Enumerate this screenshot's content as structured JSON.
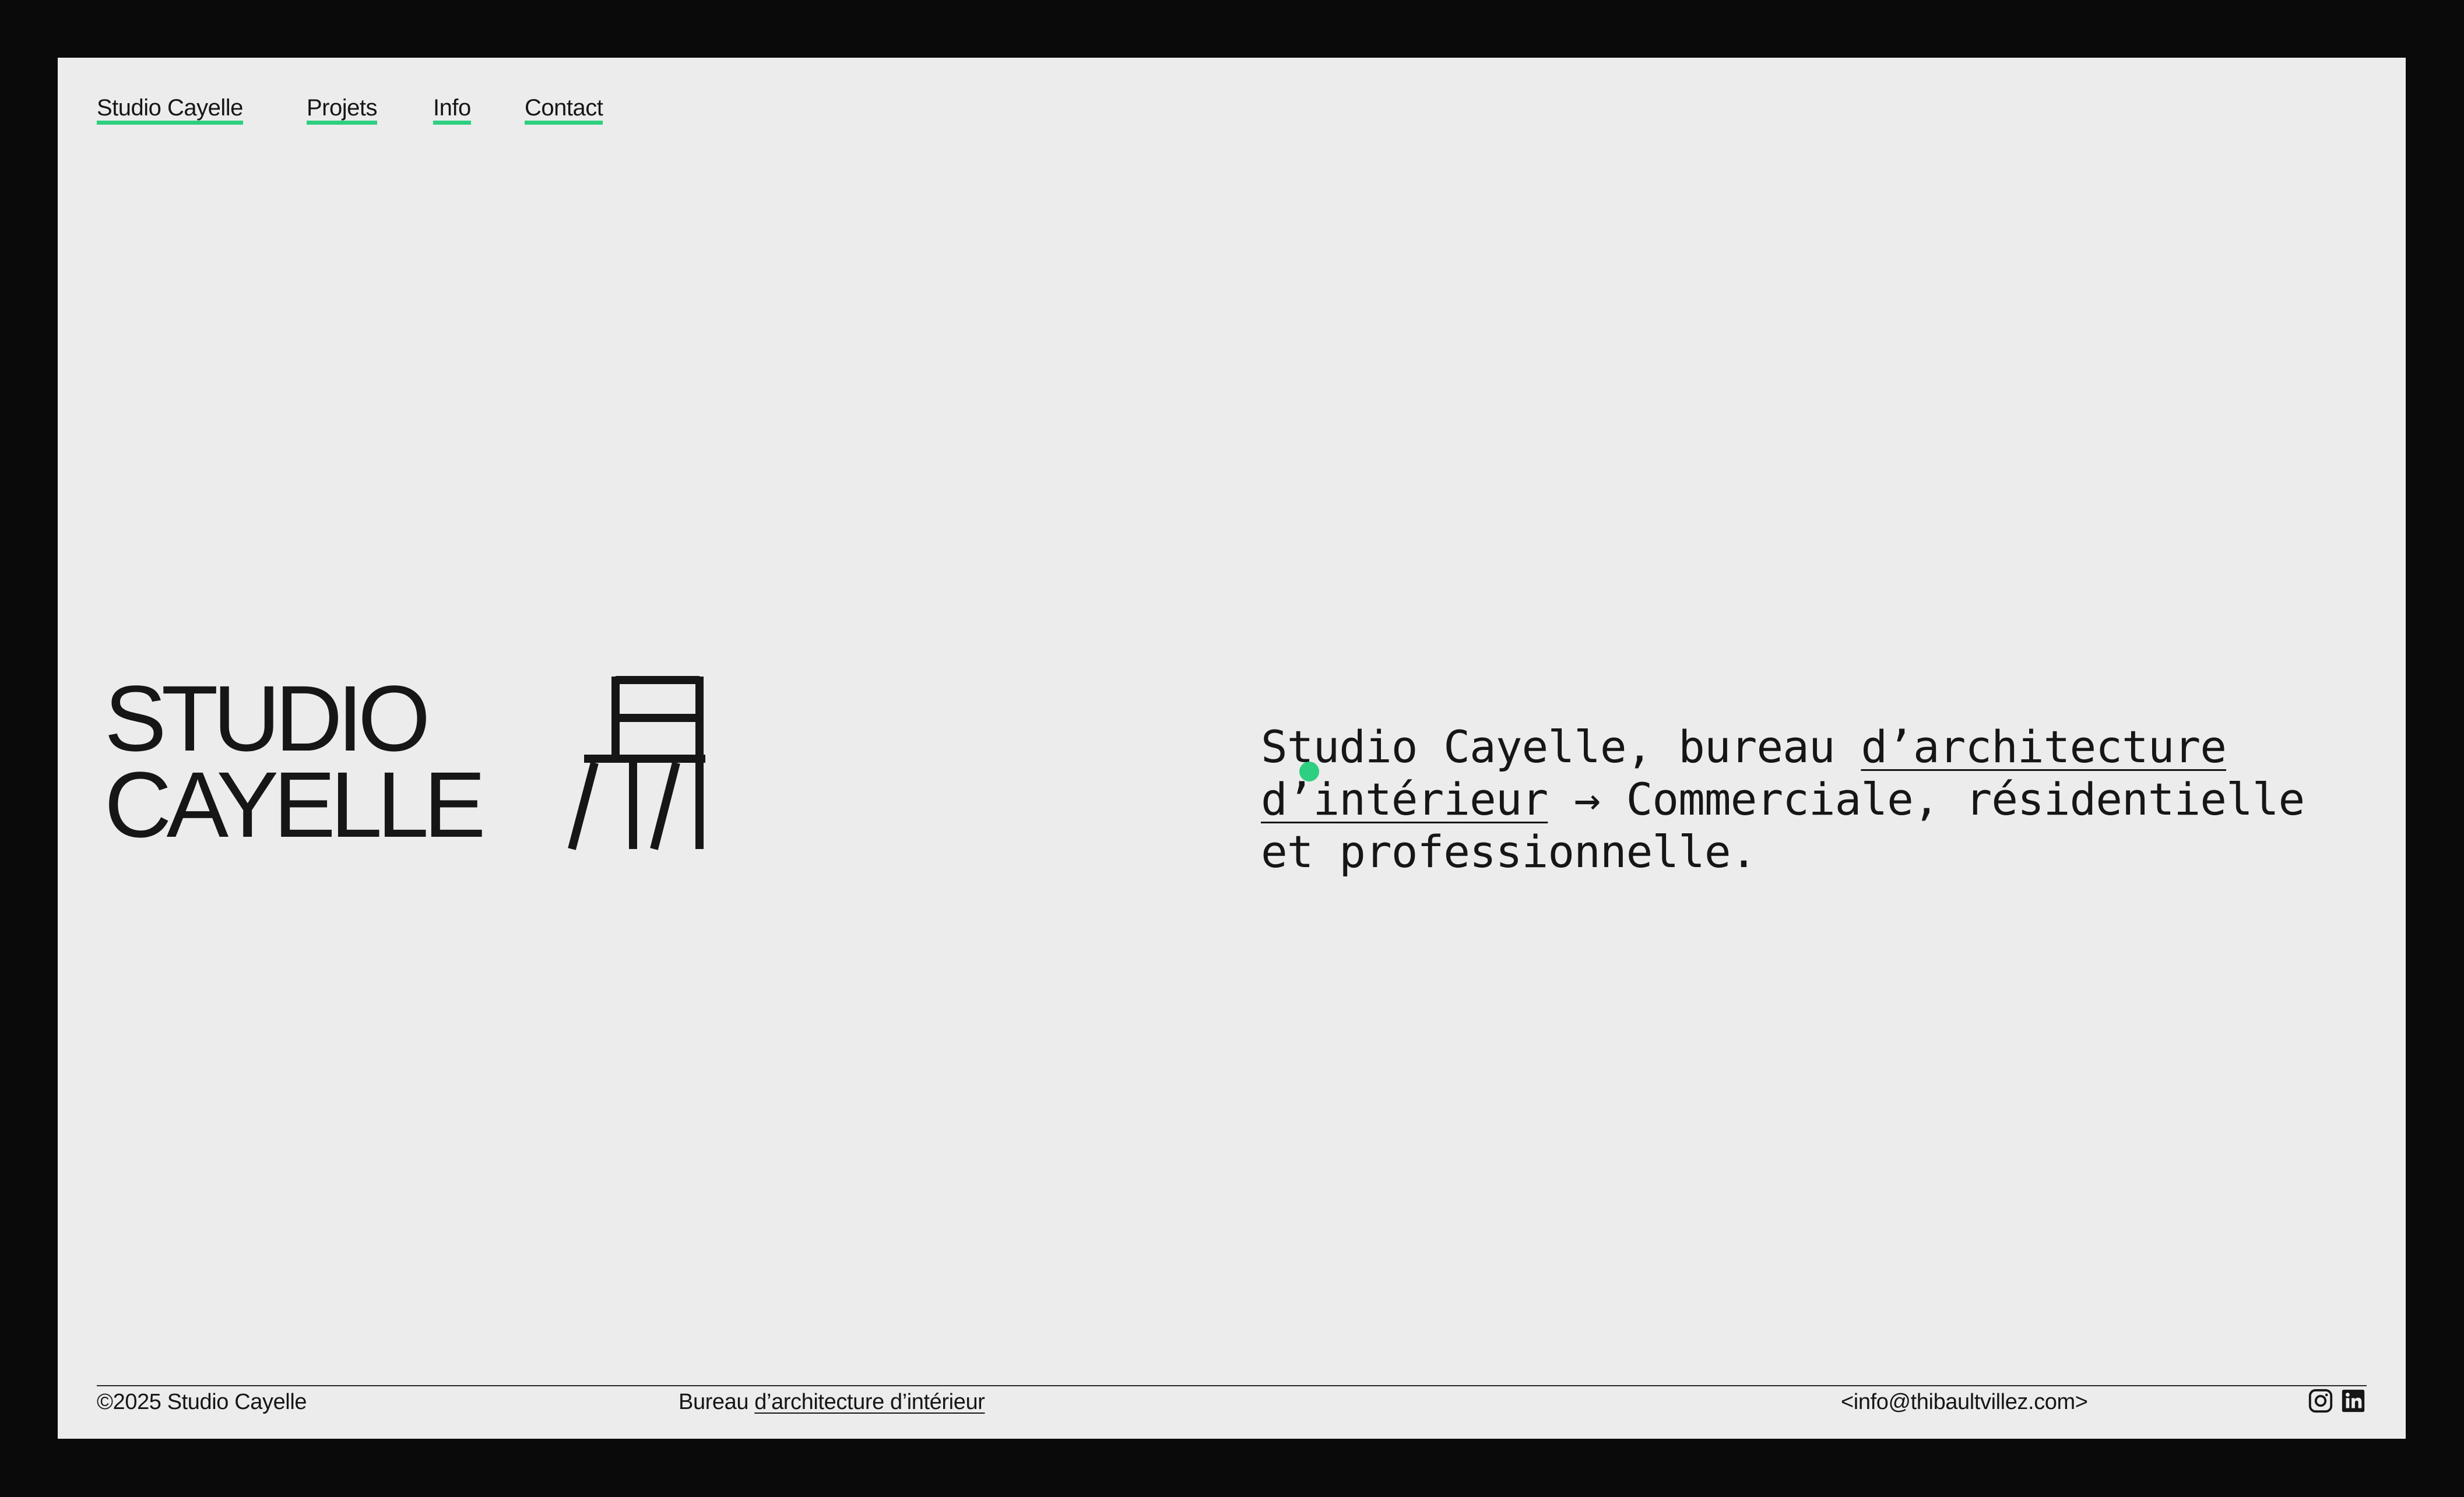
{
  "nav": {
    "brand": "Studio Cayelle",
    "items": [
      "Projets",
      "Info",
      "Contact"
    ]
  },
  "hero": {
    "logo_line1": "STUDIO",
    "logo_line2": "CAYELLE",
    "logo_icon": "chair-icon",
    "desc_prefix": "Studio Cayelle, bureau ",
    "desc_link": "d’architecture d’intérieur",
    "desc_arrow": "→",
    "desc_suffix": " Commerciale, résidentielle et professionnelle."
  },
  "footer": {
    "copyright": "©2025 Studio Cayelle",
    "tagline_prefix": "Bureau ",
    "tagline_link": "d’architecture d’intérieur",
    "email": "<info@thibaultvillez.com>",
    "social": [
      "instagram-icon",
      "linkedin-icon"
    ]
  },
  "colors": {
    "accent": "#2ecf80",
    "page_bg": "#ececec",
    "frame_bg": "#0a0a0a",
    "text": "#161616"
  }
}
